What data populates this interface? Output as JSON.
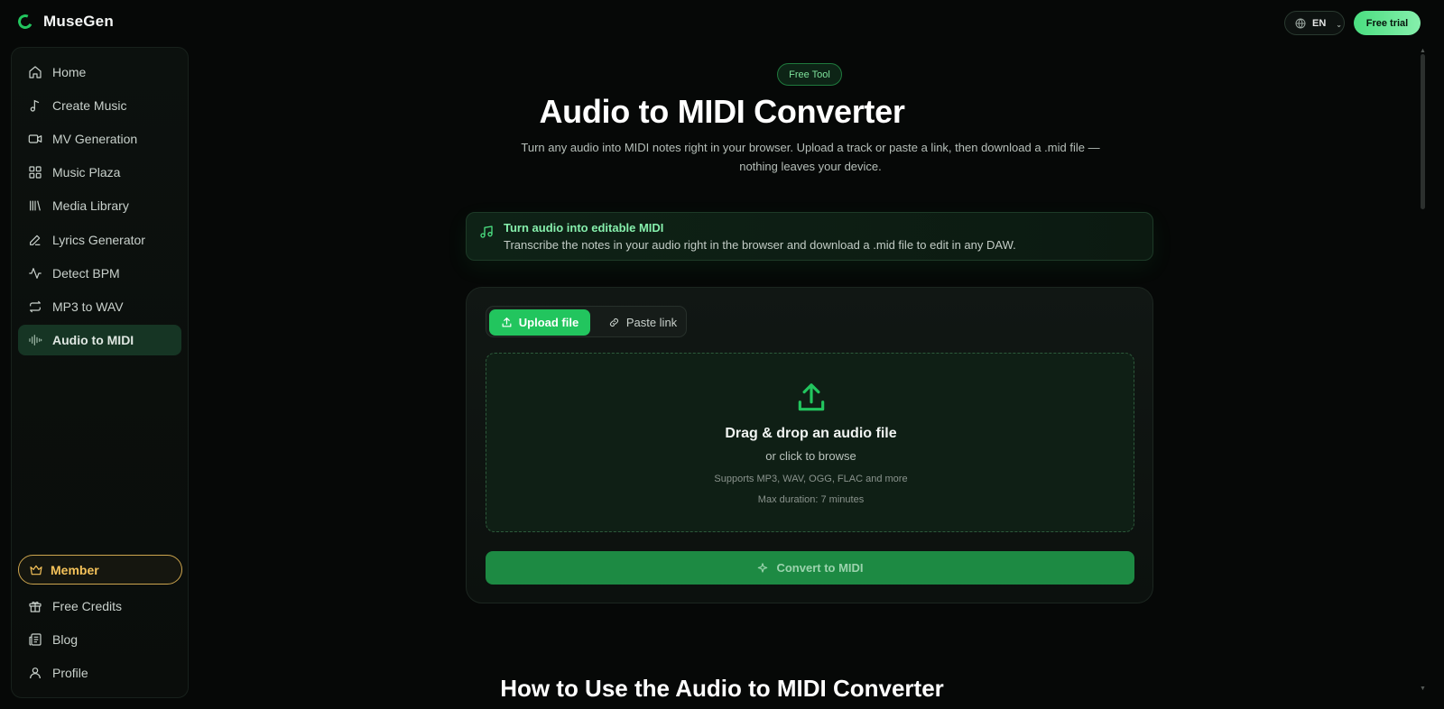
{
  "app": {
    "name": "MuseGen",
    "logo_icon": "musegen-logo"
  },
  "header": {
    "language": "EN",
    "language_icon": "globe-icon",
    "trial_button": "Free trial",
    "colors": {
      "accent": "#22c55e",
      "trial_gradient": [
        "#4ade80",
        "#86efac"
      ]
    }
  },
  "sidebar": {
    "items": [
      {
        "label": "Home",
        "icon": "home-icon"
      },
      {
        "label": "Create Music",
        "icon": "music-note-icon"
      },
      {
        "label": "MV Generation",
        "icon": "video-camera-icon"
      },
      {
        "label": "Music Plaza",
        "icon": "grid-icon"
      },
      {
        "label": "Media Library",
        "icon": "library-icon"
      },
      {
        "label": "Lyrics Generator",
        "icon": "pen-icon"
      },
      {
        "label": "Detect BPM",
        "icon": "pulse-icon"
      },
      {
        "label": "MP3 to WAV",
        "icon": "repeat-icon"
      },
      {
        "label": "Audio to MIDI",
        "icon": "waveform-icon",
        "active": true
      }
    ],
    "member": {
      "label": "Member",
      "icon": "crown-icon",
      "color": "#f4c25a"
    },
    "bottom_items": [
      {
        "label": "Free Credits",
        "icon": "gift-icon"
      },
      {
        "label": "Blog",
        "icon": "newspaper-icon"
      },
      {
        "label": "Profile",
        "icon": "user-icon"
      }
    ]
  },
  "main": {
    "badge": "Free Tool",
    "title": "Audio to MIDI Converter",
    "subtitle": "Turn any audio into MIDI notes right in your browser. Upload a track or paste a link, then download a .mid file — nothing leaves your device.",
    "info": {
      "icon": "music-notes-icon",
      "title": "Turn audio into editable MIDI",
      "text": "Transcribe the notes in your audio right in the browser and download a .mid file to edit in any DAW."
    },
    "tabs": [
      {
        "label": "Upload file",
        "icon": "upload-icon",
        "selected": true
      },
      {
        "label": "Paste link",
        "icon": "link-icon",
        "selected": false
      }
    ],
    "dropzone": {
      "icon": "upload-icon",
      "title": "Drag & drop an audio file",
      "subtitle": "or click to browse",
      "formats": "Supports MP3, WAV, OGG, FLAC and more",
      "limit": "Max duration: 7 minutes"
    },
    "convert_button": {
      "label": "Convert to MIDI",
      "icon": "sparkle-icon",
      "enabled": false
    },
    "section_heading": "How to Use the Audio to MIDI Converter"
  }
}
